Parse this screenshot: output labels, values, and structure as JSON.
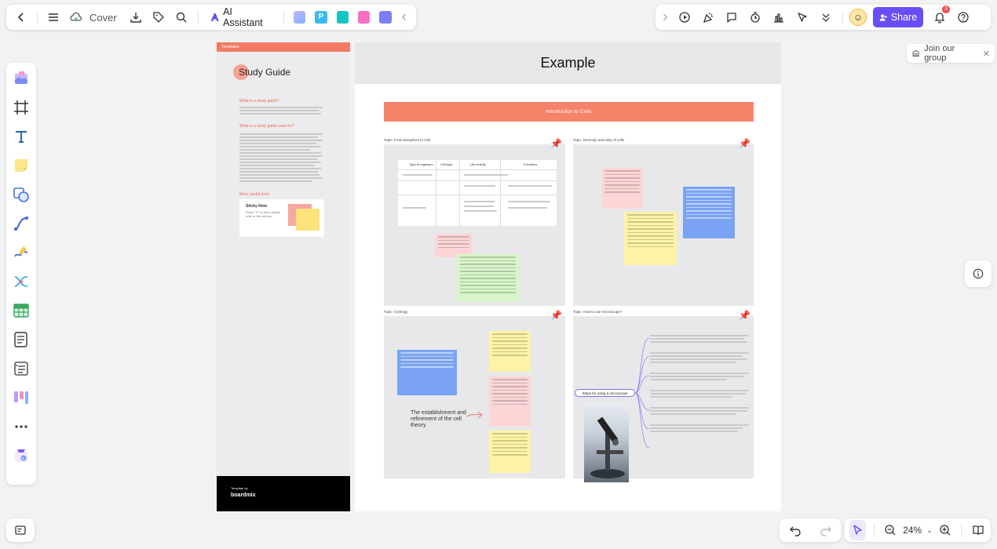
{
  "toolbar": {
    "cover_label": "Cover",
    "ai_label": "AI Assistant",
    "share_label": "Share",
    "notification_count": "3"
  },
  "join_group": {
    "label": "Join our group"
  },
  "zoom": {
    "value": "24%"
  },
  "template_panel": {
    "header": "Templates",
    "title": "Study Guide",
    "heading1": "What is a study guide?",
    "heading2": "What is a study guide used for?",
    "heading3": "More useful tools",
    "sticky_title": "Sticky Note",
    "sticky_desc": "Press \"S\" to add a sticky note to the canvas.",
    "template_by": "Template by",
    "brand": "boardmix"
  },
  "board": {
    "title": "Example",
    "banner": "Introduction to Cells",
    "topics": [
      "Topic: From Biosphere to Cell",
      "Topic: Diversity and unity of cells",
      "Topic: Cytology",
      "Topic: How to use microscope?"
    ],
    "table_headers": [
      "Type of organism",
      "Cell type",
      "Life activity",
      "Functions"
    ],
    "cell_theory_text": "The establishment and refinement of the cell theory",
    "microscope_step_label": "Steps for using a microscope"
  },
  "colors": {
    "accent": "#6a4ef5",
    "banner": "#f7826a",
    "note_yellow": "#fcf3a6",
    "note_pink": "#fcd6d6",
    "note_green": "#d7f5c9",
    "note_blue": "#7aa3f5"
  }
}
